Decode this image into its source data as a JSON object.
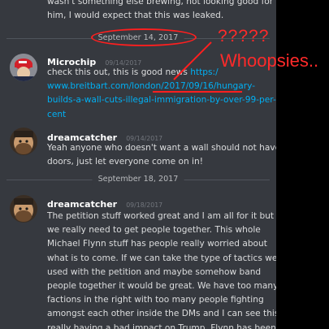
{
  "messages_top": {
    "lines": [
      "wasn't something else brewing, not looking good for",
      "him, I would expect that this was leaked."
    ]
  },
  "dividers": [
    "September 14, 2017",
    "September 18, 2017"
  ],
  "message_microchip": {
    "username": "Microchip",
    "timestamp": "09/14/2017",
    "line1_text": "check this out, this is good news ",
    "line1_link": "https:/",
    "line2_link": "www.breitbart.com/london/2017/09/16/hungary-",
    "line3_link": "builds-a-wall-cuts-illegal-immigration-by-over-99-per-",
    "line4_link": "cent"
  },
  "message_dreamcatcher_1": {
    "username": "dreamcatcher",
    "timestamp": "09/14/2017",
    "lines": [
      "Yeah anyone who doesn't want a wall should not have",
      "doors, just let everyone come on in!"
    ]
  },
  "message_dreamcatcher_2": {
    "username": "dreamcatcher",
    "timestamp": "09/18/2017",
    "lines": [
      "The petition stuff worked great and I am all for it but",
      "we really need to get people together. This whole",
      "Michael Flynn stuff has people really worried about",
      "what is to come. If we can take the type of tactics we",
      "used with the petition and maybe somehow band",
      "people together it would be great. We have too many",
      "factions in the right with too many people fighting",
      "amongst each other inside the DMs and I can see this",
      "really having a bad impact on Trump. Flynn has been a"
    ]
  },
  "annotations": {
    "question_marks": "?????",
    "exclamation": "Whoopsies..",
    "color": "#ff1f1f"
  },
  "colors": {
    "chat_background": "#36393f",
    "text": "#dcddde",
    "link": "#00b0f4",
    "username": "#ffffff",
    "timestamp": "#72767d"
  }
}
